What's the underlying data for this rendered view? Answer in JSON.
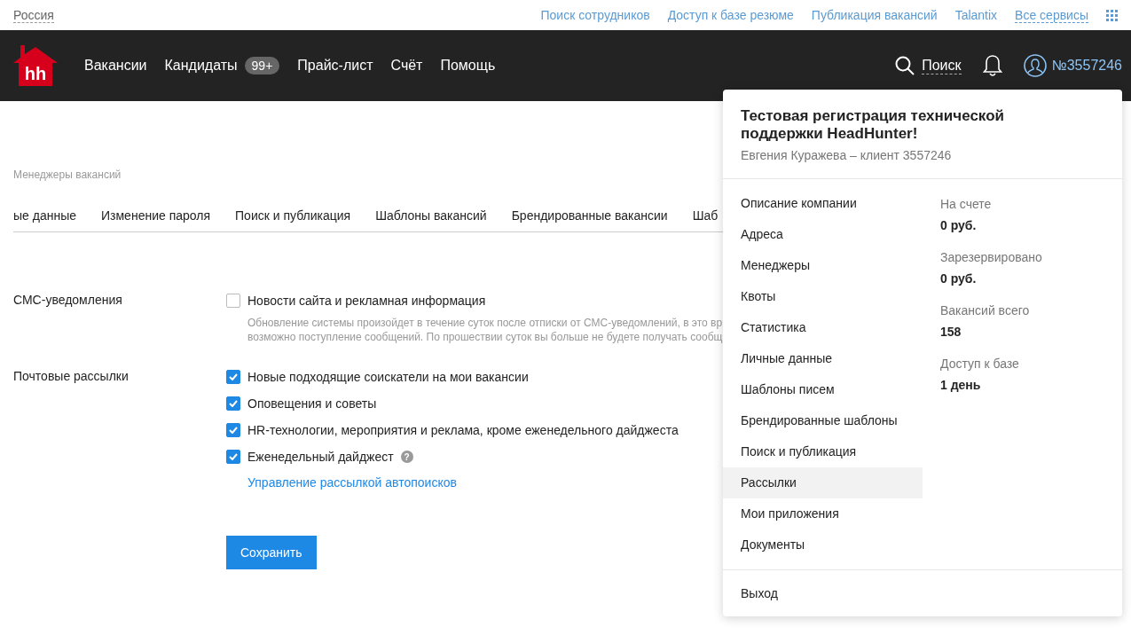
{
  "top_bar": {
    "region": "Россия",
    "links": [
      "Поиск сотрудников",
      "Доступ к базе резюме",
      "Публикация вакансий",
      "Talantix"
    ],
    "all_services": "Все сервисы"
  },
  "header": {
    "logo": "hh",
    "nav": [
      {
        "label": "Вакансии"
      },
      {
        "label": "Кандидаты",
        "badge": "99+"
      },
      {
        "label": "Прайс-лист"
      },
      {
        "label": "Счёт"
      },
      {
        "label": "Помощь"
      }
    ],
    "search": "Поиск",
    "account": "№3557246"
  },
  "breadcrumb": "Менеджеры вакансий",
  "tabs": [
    {
      "label": "ые данные",
      "selected": false
    },
    {
      "label": "Изменение пароля",
      "selected": false
    },
    {
      "label": "Поиск и публикация",
      "selected": false
    },
    {
      "label": "Шаблоны вакансий",
      "selected": false
    },
    {
      "label": "Брендированные вакансии",
      "selected": false
    },
    {
      "label": "Шаб",
      "selected": false
    }
  ],
  "sections": [
    {
      "label": "СМС-уведомления",
      "options": [
        {
          "text": "Новости сайта и рекламная информация",
          "checked": false,
          "hint": [
            "Обновление системы произойдет в течение суток после отписки от СМС-уведомлений, в это вр",
            "возможно поступление сообщений. По прошествии суток вы больше не будете получать сообщ"
          ]
        }
      ]
    },
    {
      "label": "Почтовые рассылки",
      "options": [
        {
          "text": "Новые подходящие соискатели на мои вакансии",
          "checked": true
        },
        {
          "text": "Оповещения и советы",
          "checked": true
        },
        {
          "text": "HR-технологии, мероприятия и реклама, кроме еженедельного дайджеста",
          "checked": true
        },
        {
          "text": "Еженедельный дайджест",
          "checked": true,
          "help": "?"
        }
      ],
      "link": "Управление рассылкой автопоисков"
    }
  ],
  "save_button": "Сохранить",
  "dropdown": {
    "title": "Тестовая регистрация технической поддержки HeadHunter!",
    "subtitle": "Евгения Куражева – клиент 3557246",
    "menu": [
      {
        "label": "Описание компании",
        "selected": false
      },
      {
        "label": "Адреса",
        "selected": false
      },
      {
        "label": "Менеджеры",
        "selected": false
      },
      {
        "label": "Квоты",
        "selected": false
      },
      {
        "label": "Статистика",
        "selected": false
      },
      {
        "label": "Личные данные",
        "selected": false
      },
      {
        "label": "Шаблоны писем",
        "selected": false
      },
      {
        "label": "Брендированные шаблоны",
        "selected": false
      },
      {
        "label": "Поиск и публикация",
        "selected": false
      },
      {
        "label": "Рассылки",
        "selected": true
      },
      {
        "label": "Мои приложения",
        "selected": false
      },
      {
        "label": "Документы",
        "selected": false
      }
    ],
    "stats": [
      {
        "label": "На счете",
        "value": "0 руб."
      },
      {
        "label": "Зарезервировано",
        "value": "0 руб."
      },
      {
        "label": "Вакансий всего",
        "value": "158"
      },
      {
        "label": "Доступ к базе",
        "value": "1 день"
      }
    ],
    "logout": "Выход"
  }
}
